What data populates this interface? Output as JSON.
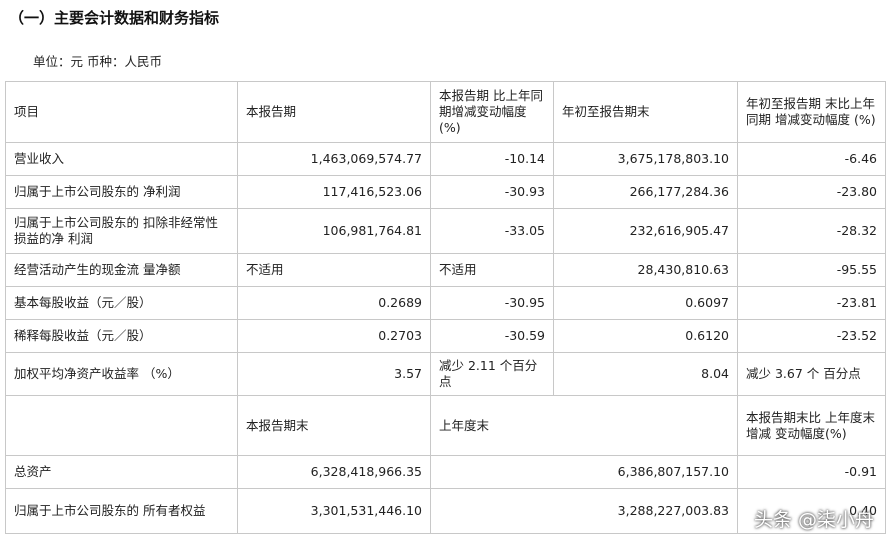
{
  "title": "（一）主要会计数据和财务指标",
  "unit_line": "单位：元 币种：人民币",
  "header": [
    "项目",
    "本报告期",
    "本报告期 比上年同 期增减变动幅度 (%)",
    "年初至报告期末",
    "年初至报告期 末比上年同期 增减变动幅度 (%)"
  ],
  "rows": [
    [
      "营业收入",
      "1,463,069,574.77",
      "-10.14",
      "3,675,178,803.10",
      "-6.46"
    ],
    [
      "归属于上市公司股东的 净利润",
      "117,416,523.06",
      "-30.93",
      "266,177,284.36",
      "-23.80"
    ],
    [
      "归属于上市公司股东的 扣除非经常性损益的净 利润",
      "106,981,764.81",
      "-33.05",
      "232,616,905.47",
      "-28.32"
    ],
    [
      "经营活动产生的现金流 量净额",
      "不适用",
      "不适用",
      "28,430,810.63",
      "-95.55"
    ],
    [
      "基本每股收益（元／股）",
      "0.2689",
      "-30.95",
      "0.6097",
      "-23.81"
    ],
    [
      "稀释每股收益（元／股）",
      "0.2703",
      "-30.59",
      "0.6120",
      "-23.52"
    ],
    [
      "加权平均净资产收益率 （%）",
      "3.57",
      "减少 2.11 个百分点",
      "8.04",
      "减少 3.67 个 百分点"
    ]
  ],
  "subheader": [
    "",
    "本报告期末",
    "上年度末",
    "本报告期末比 上年度末增减 变动幅度(%)"
  ],
  "bottom_rows": [
    [
      "总资产",
      "6,328,418,966.35",
      "6,386,807,157.10",
      "-0.91"
    ],
    [
      "归属于上市公司股东的 所有者权益",
      "3,301,531,446.10",
      "3,288,227,003.83",
      "0.40"
    ]
  ],
  "watermark": "头条 @柒小舟"
}
